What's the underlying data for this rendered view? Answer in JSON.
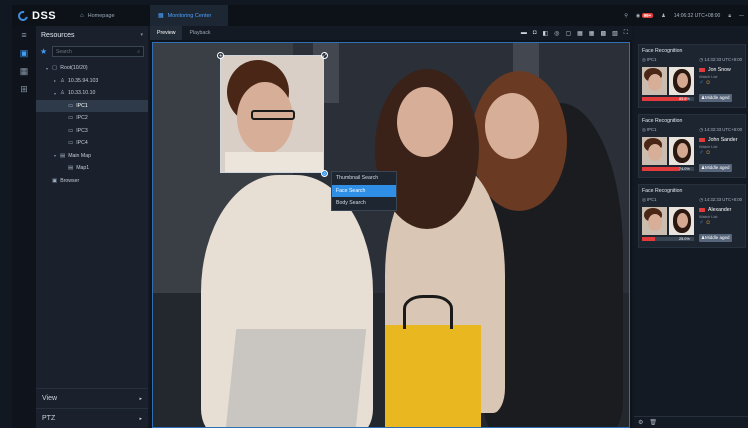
{
  "app": {
    "logo_text": "DSS"
  },
  "topbar": {
    "tabs": [
      {
        "label": "Homepage",
        "icon": "home-icon"
      },
      {
        "label": "Monitoring Center",
        "icon": "grid-icon"
      }
    ],
    "alarm_badge": "99+",
    "datetime": "14:06:32 UTC+08:00"
  },
  "resources": {
    "title": "Resources",
    "search_placeholder": "Search",
    "tree": [
      {
        "label": "Root(10/20)",
        "indent": 0,
        "arrow": "▾",
        "icon": "folder-icon"
      },
      {
        "label": "10.35.94.103",
        "indent": 1,
        "arrow": "▸",
        "icon": "device-icon"
      },
      {
        "label": "10.33.10.10",
        "indent": 1,
        "arrow": "▾",
        "icon": "device-icon"
      },
      {
        "label": "IPC1",
        "indent": 2,
        "arrow": "",
        "icon": "camera-icon",
        "selected": true
      },
      {
        "label": "IPC2",
        "indent": 2,
        "arrow": "",
        "icon": "camera-icon"
      },
      {
        "label": "IPC3",
        "indent": 2,
        "arrow": "",
        "icon": "camera-icon"
      },
      {
        "label": "IPC4",
        "indent": 2,
        "arrow": "",
        "icon": "camera-icon"
      },
      {
        "label": "Main Map",
        "indent": 1,
        "arrow": "▾",
        "icon": "map-icon"
      },
      {
        "label": "Map1",
        "indent": 2,
        "arrow": "",
        "icon": "map-icon"
      },
      {
        "label": "Browser",
        "indent": 0,
        "arrow": "",
        "icon": "browser-icon"
      }
    ],
    "view_label": "View",
    "ptz_label": "PTZ"
  },
  "main": {
    "tabs": [
      {
        "label": "Preview",
        "active": true
      },
      {
        "label": "Playback",
        "active": false
      }
    ],
    "context_menu": [
      {
        "label": "Thumbnail Search",
        "highlighted": false
      },
      {
        "label": "Face Search",
        "highlighted": true
      },
      {
        "label": "Body Search",
        "highlighted": false
      }
    ]
  },
  "recognition": {
    "cards": [
      {
        "title": "Face Recognition",
        "channel": "IPC1",
        "time": "14:32:33 UTC+8:00",
        "name": "Jon Snow",
        "list": "Watch List",
        "similarity": "85.6%",
        "similarity_value": 85.6,
        "age": "Middle aged"
      },
      {
        "title": "Face Recognition",
        "channel": "IPC1",
        "time": "14:32:33 UTC+8:00",
        "name": "John Sander",
        "list": "Watch List",
        "similarity": "74.0%",
        "similarity_value": 74.0,
        "age": "Middle aged"
      },
      {
        "title": "Face Recognition",
        "channel": "IPC1",
        "time": "14:32:33 UTC+8:00",
        "name": "Alexander",
        "list": "Watch List",
        "similarity": "25.0%",
        "similarity_value": 25.0,
        "age": "Middle aged"
      }
    ]
  },
  "colors": {
    "accent": "#3f9df5",
    "alarm": "#e23b3b",
    "watchlist": "#e23b3b"
  }
}
